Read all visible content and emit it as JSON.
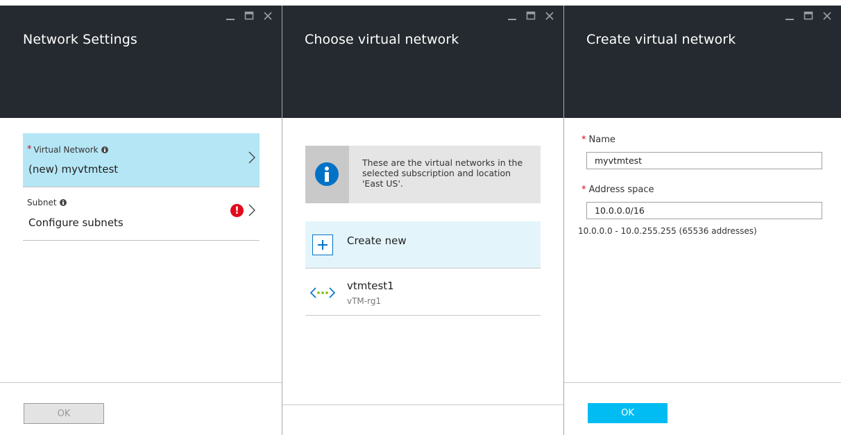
{
  "blades": {
    "network_settings": {
      "title": "Network Settings",
      "virtual_network": {
        "label": "Virtual Network",
        "value": "(new) myvtmtest"
      },
      "subnet": {
        "label": "Subnet",
        "value": "Configure subnets",
        "error_glyph": "!"
      },
      "ok_label": "OK"
    },
    "choose_vnet": {
      "title": "Choose virtual network",
      "info_text": "These are the virtual networks in the selected subscription and location 'East US'.",
      "create_new_label": "Create new",
      "networks": [
        {
          "name": "vtmtest1",
          "resource_group": "vTM-rg1"
        }
      ]
    },
    "create_vnet": {
      "title": "Create virtual network",
      "name_label": "Name",
      "name_value": "myvtmtest",
      "address_label": "Address space",
      "address_value": "10.0.0.0/16",
      "address_hint": "10.0.0.0 - 10.0.255.255 (65536 addresses)",
      "ok_label": "OK"
    }
  },
  "required_marker": "*",
  "colors": {
    "header_bg": "#252a30",
    "selected_row": "#b5e6f5",
    "accent_blue": "#00bcf2",
    "info_blue": "#0072c6",
    "error_red": "#e00b1c",
    "required_red": "#d9001b"
  },
  "icons": {
    "minimize": "minimize-icon",
    "maximize": "maximize-icon",
    "close": "close-icon",
    "chevron": "chevron-right-icon",
    "info": "info-icon",
    "error": "error-icon",
    "plus": "plus-icon",
    "vnet": "virtual-network-icon"
  }
}
